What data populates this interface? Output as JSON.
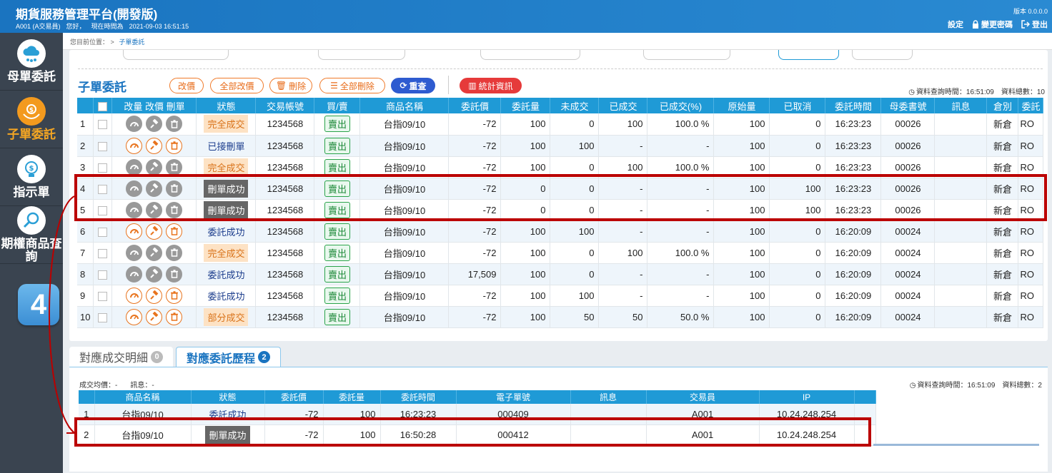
{
  "app": {
    "title": "期貨服務管理平台(開發版)",
    "user": "A001 (A交易員)",
    "greeting": "您好，",
    "time_label": "現在時間為",
    "time": "2021-09-03 16:51:15",
    "version": "版本 0.0.0.0",
    "settings": "設定",
    "change_password": "變更密碼",
    "logout": "登出"
  },
  "sidebar": {
    "items": [
      {
        "label": "母單委託",
        "icon": "cloud-network-icon"
      },
      {
        "label": "子單委託",
        "icon": "money-hands-icon",
        "active": true
      },
      {
        "label": "指示單",
        "icon": "lightbulb-dollar-icon"
      },
      {
        "label": "期權商品查詢",
        "icon": "search-magnifier-icon"
      }
    ],
    "step": "4"
  },
  "breadcrumb": {
    "prefix": "您目前位置：",
    "sep": ">",
    "current": "子單委託"
  },
  "main": {
    "title": "子單委託",
    "buttons": {
      "modify": "改價",
      "modify_all": "全部改價",
      "delete": "刪除",
      "delete_all": "全部刪除",
      "reset": "重查",
      "stats": "統計資訊"
    },
    "query_time": "資料查詢時間：16:51:09",
    "total": "資料總數：10",
    "headers": [
      "",
      "",
      "改量 改價 刪單",
      "狀態",
      "交易帳號",
      "買/賣",
      "商品名稱",
      "委託價",
      "委託量",
      "未成交",
      "已成交",
      "已成交(%)",
      "原始量",
      "已取消",
      "委託時間",
      "母委書號",
      "訊息",
      "倉別",
      "委託"
    ],
    "rows": [
      [
        "1",
        "gray",
        "完全成交",
        "full",
        "1234568",
        "賣出",
        "台指09/10",
        "-72",
        "100",
        "0",
        "100",
        "100.0 %",
        "100",
        "0",
        "16:23:23",
        "00026",
        "",
        "新倉",
        "RO"
      ],
      [
        "2",
        "orange",
        "已接刪單",
        "plain",
        "1234568",
        "賣出",
        "台指09/10",
        "-72",
        "100",
        "100",
        "-",
        "-",
        "100",
        "0",
        "16:23:23",
        "00026",
        "",
        "新倉",
        "RO"
      ],
      [
        "3",
        "gray",
        "完全成交",
        "full",
        "1234568",
        "賣出",
        "台指09/10",
        "-72",
        "100",
        "0",
        "100",
        "100.0 %",
        "100",
        "0",
        "16:23:23",
        "00026",
        "",
        "新倉",
        "RO"
      ],
      [
        "4",
        "gray",
        "刪單成功",
        "cancel",
        "1234568",
        "賣出",
        "台指09/10",
        "-72",
        "0",
        "0",
        "-",
        "-",
        "100",
        "100",
        "16:23:23",
        "00026",
        "",
        "新倉",
        "RO"
      ],
      [
        "5",
        "gray",
        "刪單成功",
        "cancel",
        "1234568",
        "賣出",
        "台指09/10",
        "-72",
        "0",
        "0",
        "-",
        "-",
        "100",
        "100",
        "16:23:23",
        "00026",
        "",
        "新倉",
        "RO"
      ],
      [
        "6",
        "orange",
        "委託成功",
        "plain",
        "1234568",
        "賣出",
        "台指09/10",
        "-72",
        "100",
        "100",
        "-",
        "-",
        "100",
        "0",
        "16:20:09",
        "00024",
        "",
        "新倉",
        "RO"
      ],
      [
        "7",
        "gray",
        "完全成交",
        "full",
        "1234568",
        "賣出",
        "台指09/10",
        "-72",
        "100",
        "0",
        "100",
        "100.0 %",
        "100",
        "0",
        "16:20:09",
        "00024",
        "",
        "新倉",
        "RO"
      ],
      [
        "8",
        "gray",
        "委託成功",
        "plain",
        "1234568",
        "賣出",
        "台指09/10",
        "17,509",
        "100",
        "0",
        "-",
        "-",
        "100",
        "0",
        "16:20:09",
        "00024",
        "",
        "新倉",
        "RO"
      ],
      [
        "9",
        "orange",
        "委託成功",
        "plain",
        "1234568",
        "賣出",
        "台指09/10",
        "-72",
        "100",
        "100",
        "-",
        "-",
        "100",
        "0",
        "16:20:09",
        "00024",
        "",
        "新倉",
        "RO"
      ],
      [
        "10",
        "orange",
        "部分成交",
        "full",
        "1234568",
        "賣出",
        "台指09/10",
        "-72",
        "100",
        "50",
        "50",
        "50.0 %",
        "100",
        "0",
        "16:20:09",
        "00024",
        "",
        "新倉",
        "RO"
      ]
    ]
  },
  "tabs": [
    {
      "label": "對應成交明細",
      "count": "0"
    },
    {
      "label": "對應委託歷程",
      "count": "2"
    }
  ],
  "detail": {
    "avg_price": "成交均價：-",
    "message": "訊息：-",
    "query_time": "資料查詢時間：16:51:09",
    "total": "資料總數：2",
    "headers": [
      "",
      "商品名稱",
      "狀態",
      "委託價",
      "委託量",
      "委託時間",
      "電子單號",
      "訊息",
      "交易員",
      "IP",
      ""
    ],
    "rows": [
      [
        "1",
        "台指09/10",
        "委託成功",
        "plain",
        "-72",
        "100",
        "16:23:23",
        "000409",
        "",
        "A001",
        "10.24.248.254"
      ],
      [
        "2",
        "台指09/10",
        "刪單成功",
        "cancel",
        "-72",
        "100",
        "16:50:28",
        "000412",
        "",
        "A001",
        "10.24.248.254"
      ]
    ]
  },
  "colors": {
    "accent": "#1a74c0",
    "highlight": "#b00000",
    "orange": "#f39a1e"
  }
}
